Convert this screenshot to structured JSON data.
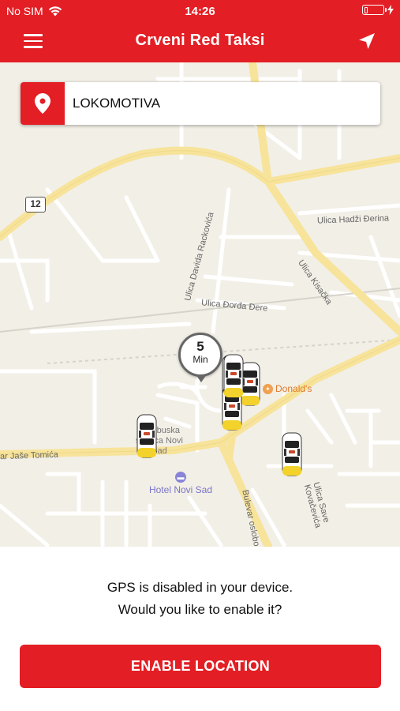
{
  "status_bar": {
    "carrier": "No SIM",
    "time": "14:26"
  },
  "header": {
    "title": "Crveni Red Taksi",
    "menu_icon": "hamburger-menu-icon",
    "locate_icon": "navigation-arrow-icon"
  },
  "search": {
    "value": "LOKOMOTIVA",
    "icon": "location-pin-icon"
  },
  "map": {
    "eta_value": "5",
    "eta_unit": "Min",
    "road_shield": "12",
    "labels": {
      "hadzi_djerina": "Ulica Hadži Đerina",
      "kisacka": "Ulica Kisačka",
      "davida_rakovica": "Ulica Davida Rackovića",
      "djordja_dere": "Ulica Đorđa Đere",
      "mcdonalds": "Donald's",
      "station": "Autobuska stanica Novi Sad",
      "hotel": "Hotel Novi Sad",
      "jase_tomica": "ar Jaše Tomića",
      "bulevar": "Bulevar oslobo",
      "save_kovacevica": "Ulica Save Kovačevića"
    },
    "taxi_count": 6
  },
  "gps_prompt": {
    "line1": "GPS is disabled in your device.",
    "line2": "Would you like to enable it?",
    "button_label": "ENABLE LOCATION"
  },
  "colors": {
    "brand_red": "#e31e24",
    "map_background": "#f2efe6",
    "major_road": "#f7e39a"
  }
}
